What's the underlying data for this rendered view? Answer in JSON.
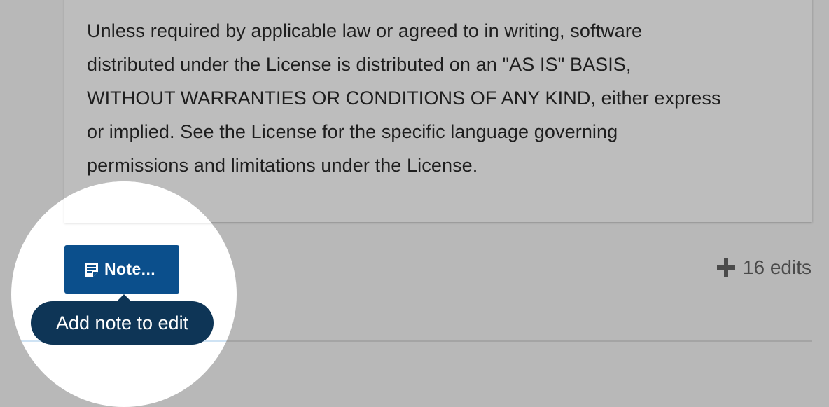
{
  "license": {
    "lines": [
      "Unless required by applicable law or agreed to in writing, software",
      "distributed under the License is distributed on an \"AS IS\" BASIS,",
      "WITHOUT WARRANTIES OR CONDITIONS OF ANY KIND, either express",
      "or implied. See the License for the specific language governing",
      "permissions and limitations under the License."
    ]
  },
  "note_button": {
    "label": "Note...",
    "icon": "note-icon",
    "color": "#0b4f8c"
  },
  "tooltip": {
    "text": "Add note to edit",
    "color": "#0e3556"
  },
  "edits": {
    "icon": "plus-icon",
    "label": "16 edits"
  }
}
